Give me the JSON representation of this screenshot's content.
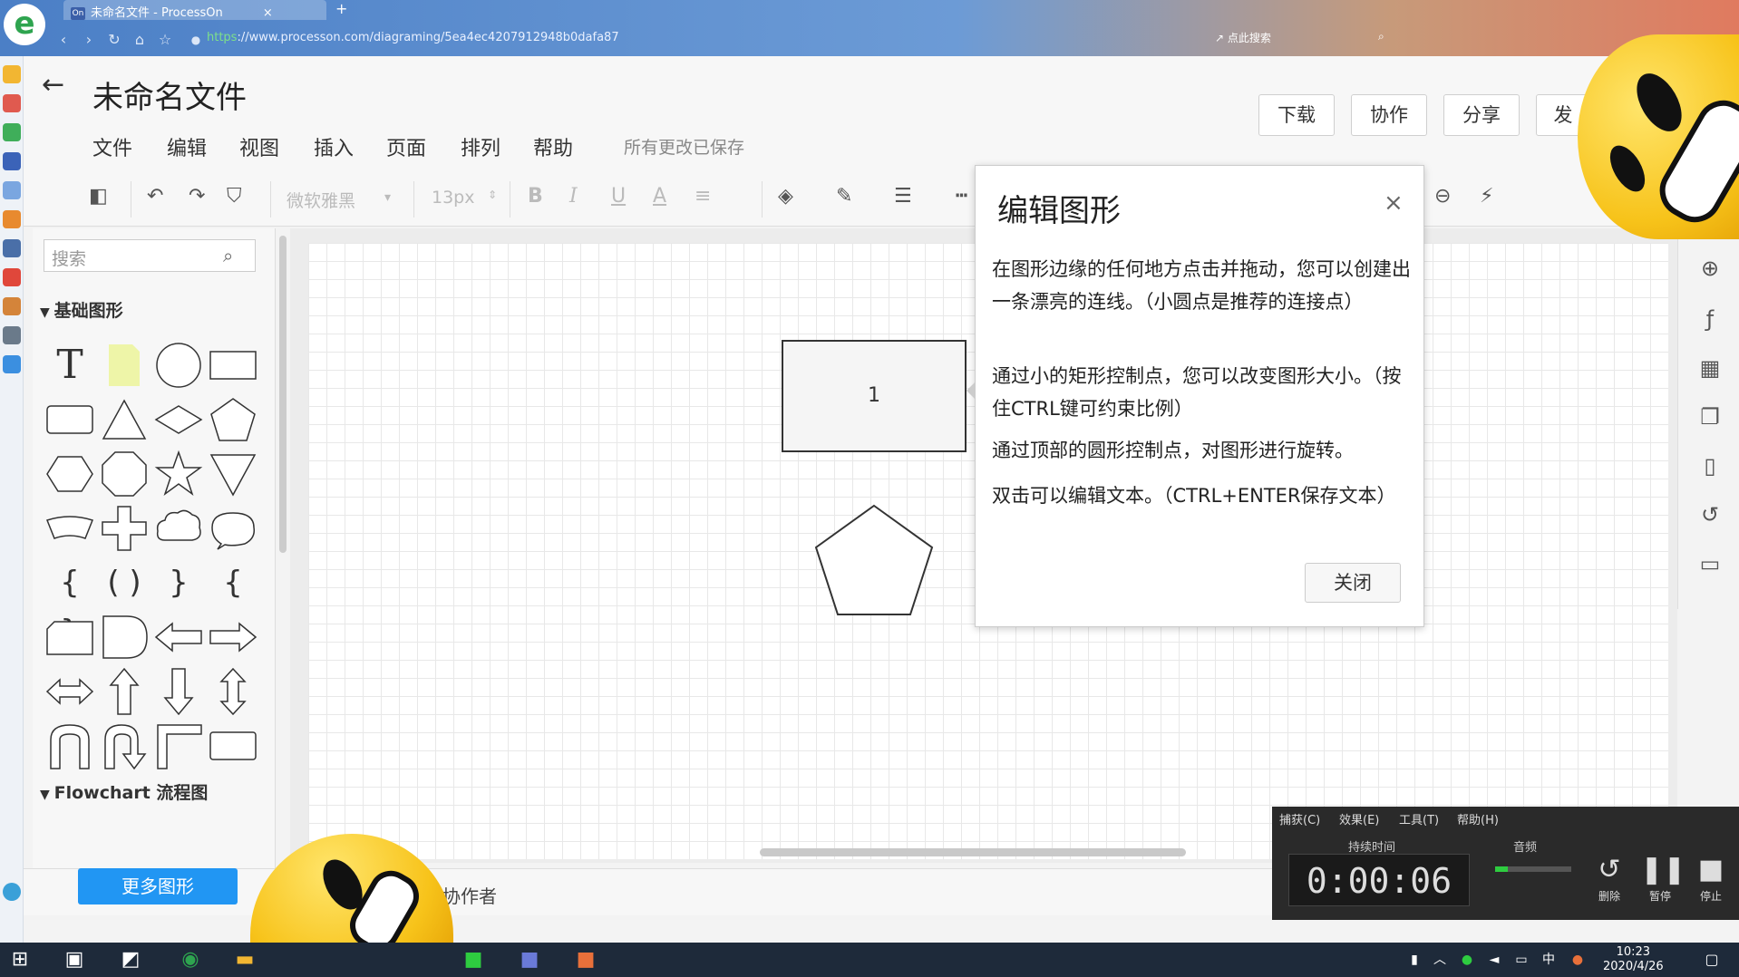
{
  "browser": {
    "tab_title": "未命名文件 - ProcessOn",
    "tab_favicon": "On",
    "url_scheme": "https",
    "url_rest": "://www.processon.com/diagraming/5ea4ec4207912948b0dafa87",
    "search_hint": "点此搜索",
    "logo": "e"
  },
  "header": {
    "back_icon": "←",
    "title": "未命名文件",
    "menus": [
      "文件",
      "编辑",
      "视图",
      "插入",
      "页面",
      "排列",
      "帮助"
    ],
    "saved_status": "所有更改已保存",
    "buttons": [
      "下载",
      "协作",
      "分享",
      "发"
    ]
  },
  "toolbar": {
    "font": "微软雅黑",
    "font_size": "13px",
    "bold": "B",
    "italic": "I",
    "underline": "U",
    "font_color": "A"
  },
  "shape_panel": {
    "search_placeholder": "搜索",
    "category_basic": "基础图形",
    "category_flowchart": "Flowchart 流程图",
    "more_button": "更多图形",
    "text_tool": "T"
  },
  "canvas": {
    "rect_label": "1"
  },
  "dialog": {
    "title": "编辑图形",
    "close_icon": "×",
    "p1": "在图形边缘的任何地方点击并拖动，您可以创建出一条漂亮的连线。（小圆点是推荐的连接点）",
    "p2": "通过小的矩形控制点，您可以改变图形大小。（按住CTRL键可约束比例）",
    "p3": "通过顶部的圆形控制点，对图形进行旋转。",
    "p4": "双击可以编辑文本。（CTRL+ENTER保存文本）",
    "close_button": "关闭"
  },
  "bottom": {
    "collaborators": "协作者"
  },
  "recorder": {
    "menus": [
      "捕获(C)",
      "效果(E)",
      "工具(T)",
      "帮助(H)"
    ],
    "duration_label": "持续时间",
    "audio_label": "音频",
    "time": "0:00:06",
    "delete": "删除",
    "pause": "暂停",
    "stop": "停止"
  },
  "taskbar": {
    "time": "10:23",
    "date": "2020/4/26",
    "ime": "中"
  },
  "colors": {
    "accent": "#2196f3",
    "recorder_bg": "#2a2a2a",
    "taskbar_bg": "#1e2a3a"
  }
}
